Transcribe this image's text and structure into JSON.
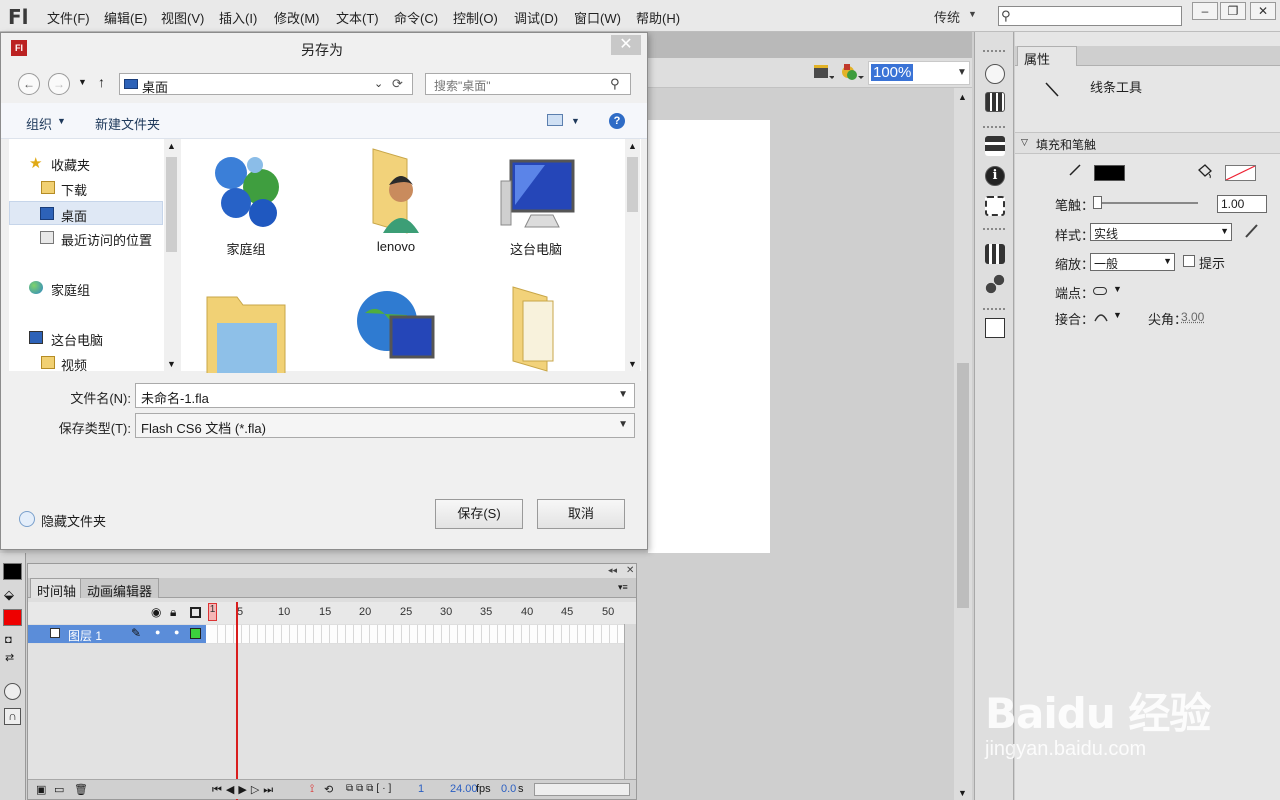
{
  "app": {
    "logo": "Fl",
    "menu": [
      "文件(F)",
      "编辑(E)",
      "视图(V)",
      "插入(I)",
      "修改(M)",
      "文本(T)",
      "命令(C)",
      "控制(O)",
      "调试(D)",
      "窗口(W)",
      "帮助(H)"
    ],
    "workspace": "传统",
    "search_placeholder": ""
  },
  "stage": {
    "zoom": "100%"
  },
  "properties": {
    "tab": "属性",
    "tool_name": "线条工具",
    "section": "填充和笔触",
    "stroke_label": "笔触：",
    "stroke_value": "1.00",
    "style_label": "样式：",
    "style_value": "实线",
    "scale_label": "缩放：",
    "scale_value": "一般",
    "hint_label": "提示",
    "cap_label": "端点：",
    "join_label": "接合：",
    "miter_label": "尖角：",
    "miter_value": "3.00"
  },
  "timeline": {
    "tabs": [
      "时间轴",
      "动画编辑器"
    ],
    "layer_name": "图层 1",
    "ticks": [
      "1",
      "5",
      "10",
      "15",
      "20",
      "25",
      "30",
      "35",
      "40",
      "45",
      "50"
    ],
    "current_frame": "1",
    "fps": "24.00",
    "fps_unit": "fps",
    "time": "0.0",
    "time_unit": "s"
  },
  "dialog": {
    "title": "另存为",
    "icon_text": "Fl",
    "address": "桌面",
    "search_placeholder": "搜索\"桌面\"",
    "organize": "组织",
    "new_folder": "新建文件夹",
    "nav": [
      {
        "label": "收藏夹",
        "indent": 0
      },
      {
        "label": "下载",
        "indent": 1
      },
      {
        "label": "桌面",
        "indent": 1,
        "selected": true
      },
      {
        "label": "最近访问的位置",
        "indent": 1
      },
      {
        "label": "家庭组",
        "indent": 0
      },
      {
        "label": "这台电脑",
        "indent": 0
      },
      {
        "label": "视频",
        "indent": 1
      }
    ],
    "files": [
      "家庭组",
      "lenovo",
      "这台电脑",
      "",
      "",
      ""
    ],
    "filename_label": "文件名(N):",
    "filename_value": "未命名-1.fla",
    "filetype_label": "保存类型(T):",
    "filetype_value": "Flash CS6 文档 (*.fla)",
    "hide_folders": "隐藏文件夹",
    "save_button": "保存(S)",
    "cancel_button": "取消"
  },
  "watermark": {
    "main": "Baidu 经验",
    "sub": "jingyan.baidu.com"
  }
}
